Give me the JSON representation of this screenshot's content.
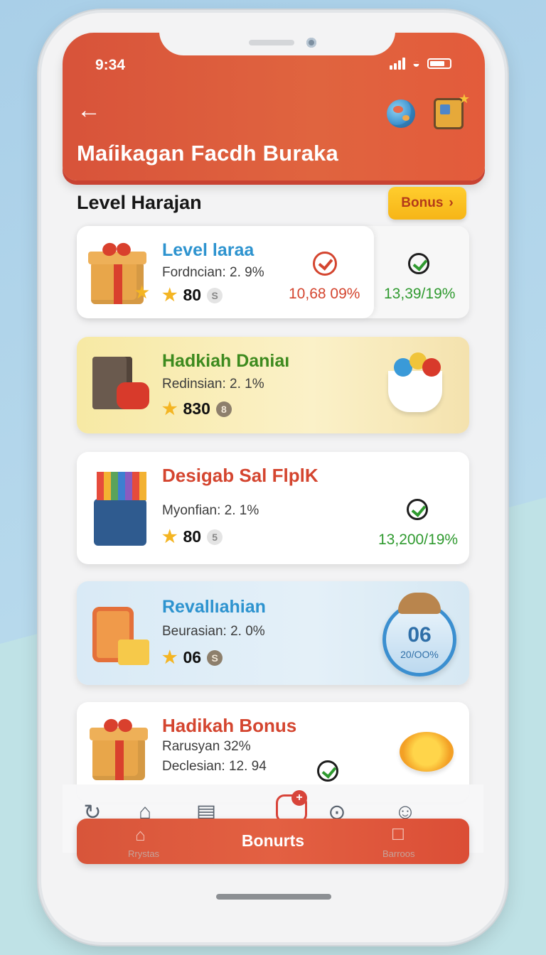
{
  "status_bar": {
    "time": "9:34"
  },
  "header": {
    "title": "Maíikagan Facdh Buraka"
  },
  "section": {
    "title": "Level Harajan",
    "bonus_button": "Bonus"
  },
  "cards": [
    {
      "name": "Level laraa",
      "desc": "Fordncian: 2. 9%",
      "points": "80",
      "coin": "S",
      "pct_left": "10,68 09%",
      "pct_right": "13,39/19%",
      "name_color": "#2d93cf"
    },
    {
      "name": "Hadkiah Daniaı",
      "desc": "Redinsian: 2. 1%",
      "points": "830",
      "coin": "8",
      "name_color": "#3d8a1e"
    },
    {
      "name": "Desigab Sal FlplK",
      "desc": "Myonfian:  2. 1%",
      "points": "80",
      "coin": "5",
      "pct_right": "13,200/19%",
      "name_color": "#d4452f"
    },
    {
      "name": "Revallıahian",
      "desc": "Beurasian: 2. 0%",
      "points": "06",
      "coin": "S",
      "badge_value": "06",
      "badge_sub": "20/OO%",
      "name_color": "#2d93cf"
    },
    {
      "name": "Hadikah Bonus",
      "desc": "Rarusyan 32%",
      "desc2": "Declesian: 12. 94",
      "name_color": "#d4452f"
    }
  ],
  "bottom_nav": {
    "cta_label": "Bonurts",
    "left_sub": "Rrystas",
    "right_sub": "Barroos"
  },
  "colors": {
    "accent": "#d8533a",
    "success": "#2f9a2f",
    "gold": "#f6b517"
  }
}
